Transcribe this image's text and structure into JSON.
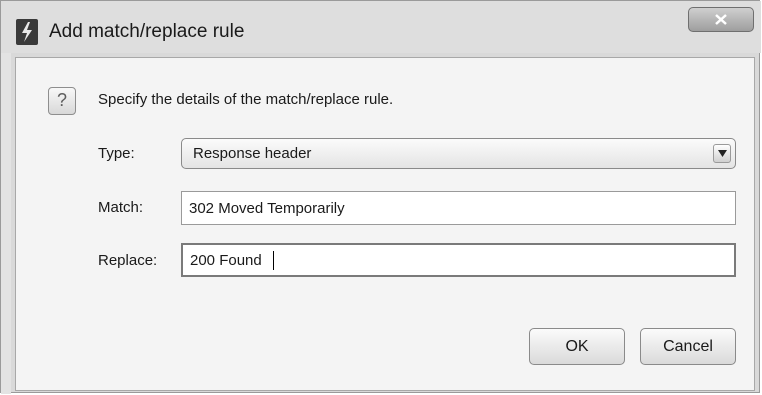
{
  "window": {
    "title": "Add match/replace rule",
    "close_glyph": "X"
  },
  "icons": {
    "app": "lightning-bolt-icon",
    "close": "close-icon",
    "help": "question-mark-icon",
    "dropdown": "chevron-down-icon"
  },
  "dialog": {
    "help_glyph": "?",
    "instruction": "Specify the details of the match/replace rule."
  },
  "form": {
    "type_label": "Type:",
    "type_value": "Response header",
    "match_label": "Match:",
    "match_value": "302 Moved Temporarily",
    "replace_label": "Replace:",
    "replace_value": "200 Found"
  },
  "buttons": {
    "ok_label": "OK",
    "cancel_label": "Cancel"
  }
}
